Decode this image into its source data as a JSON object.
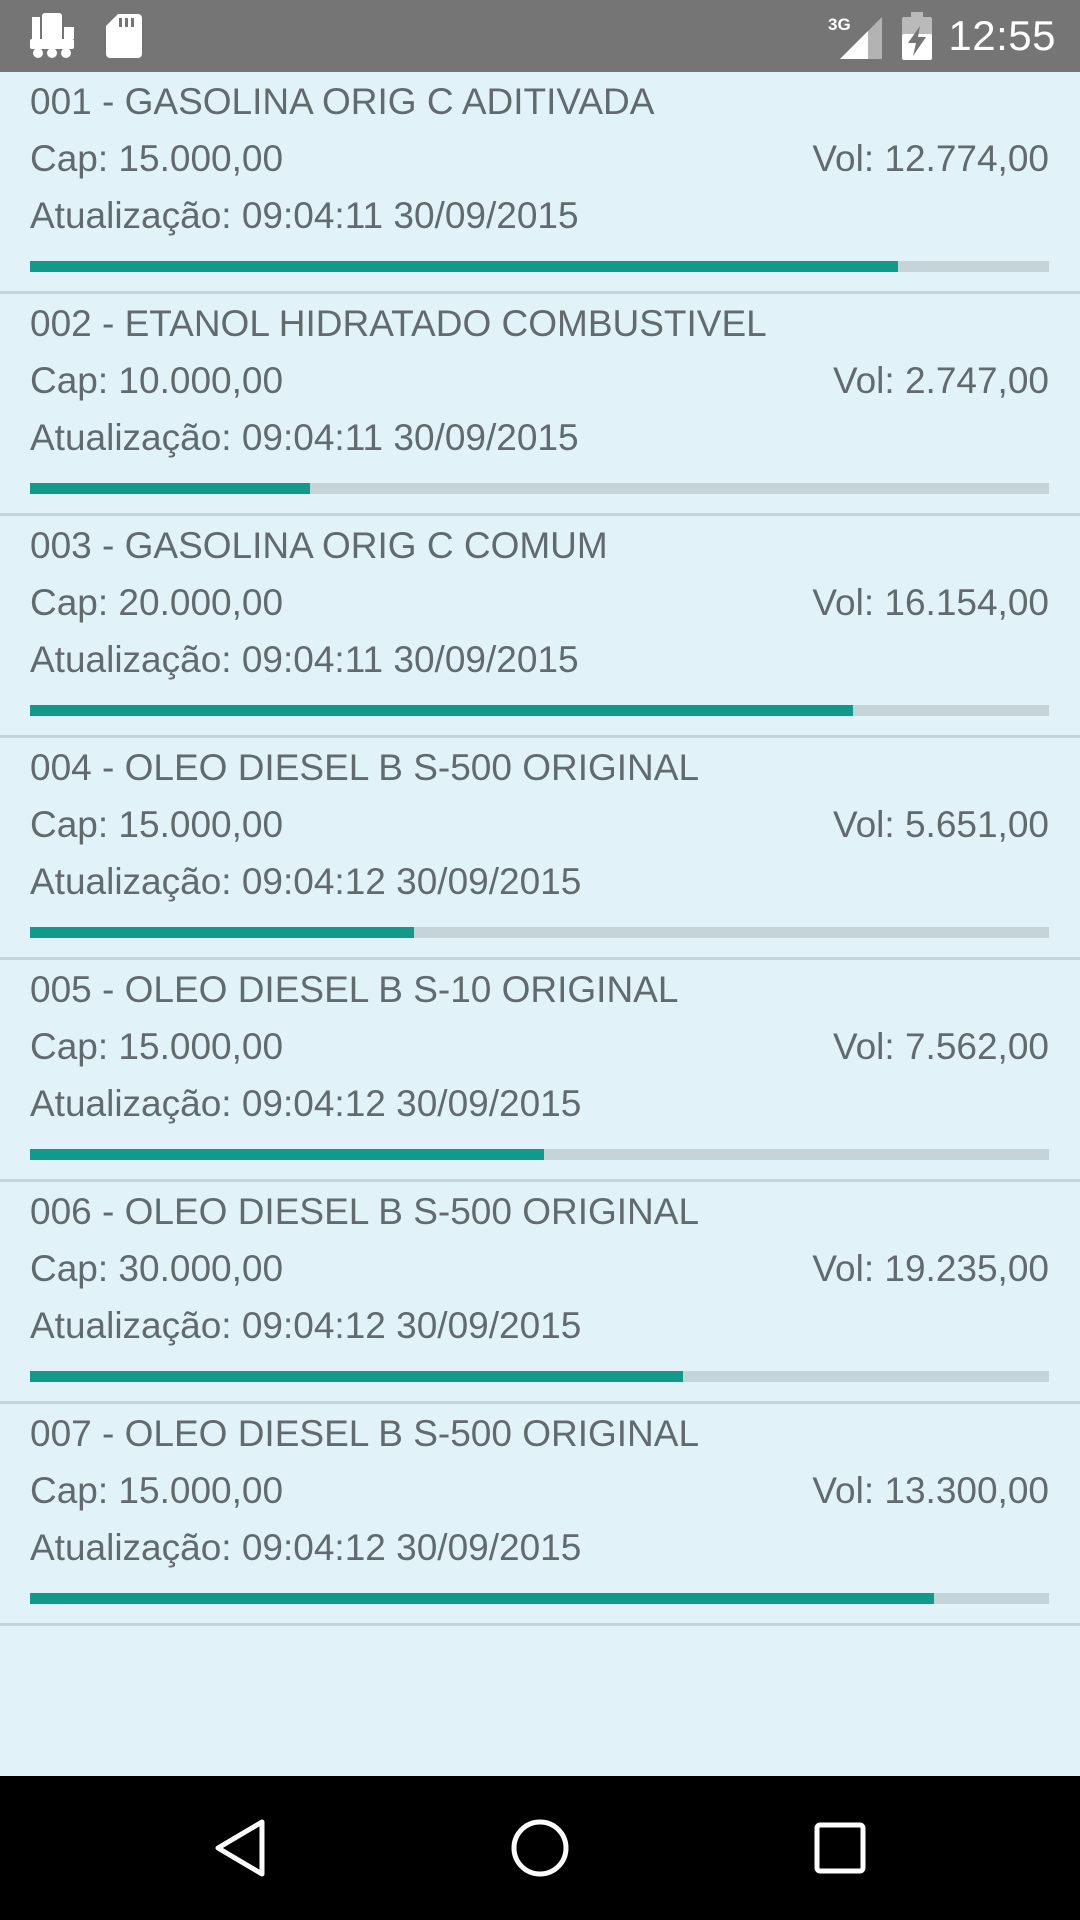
{
  "status_bar": {
    "time": "12:55",
    "network": "3G",
    "icons_left": [
      "tanker-truck-icon",
      "sd-card-icon"
    ],
    "icons_right": [
      "signal-3g-icon",
      "battery-charging-icon"
    ]
  },
  "tanks": [
    {
      "name": "001 - GASOLINA ORIG C ADITIVADA",
      "cap": "Cap: 15.000,00",
      "vol": "Vol: 12.774,00",
      "updated": "Atualização: 09:04:11 30/09/2015",
      "fill_fraction": 0.8516
    },
    {
      "name": "002 - ETANOL HIDRATADO COMBUSTIVEL",
      "cap": "Cap: 10.000,00",
      "vol": "Vol: 2.747,00",
      "updated": "Atualização: 09:04:11 30/09/2015",
      "fill_fraction": 0.2747
    },
    {
      "name": "003 - GASOLINA ORIG C COMUM",
      "cap": "Cap: 20.000,00",
      "vol": "Vol: 16.154,00",
      "updated": "Atualização: 09:04:11 30/09/2015",
      "fill_fraction": 0.8077
    },
    {
      "name": "004 - OLEO DIESEL B S-500 ORIGINAL",
      "cap": "Cap: 15.000,00",
      "vol": "Vol: 5.651,00",
      "updated": "Atualização: 09:04:12 30/09/2015",
      "fill_fraction": 0.3767
    },
    {
      "name": "005 - OLEO DIESEL B S-10 ORIGINAL",
      "cap": "Cap: 15.000,00",
      "vol": "Vol: 7.562,00",
      "updated": "Atualização: 09:04:12 30/09/2015",
      "fill_fraction": 0.5041
    },
    {
      "name": "006 - OLEO DIESEL B S-500 ORIGINAL",
      "cap": "Cap: 30.000,00",
      "vol": "Vol: 19.235,00",
      "updated": "Atualização: 09:04:12 30/09/2015",
      "fill_fraction": 0.6412
    },
    {
      "name": "007 - OLEO DIESEL B S-500 ORIGINAL",
      "cap": "Cap: 15.000,00",
      "vol": "Vol: 13.300,00",
      "updated": "Atualização: 09:04:12 30/09/2015",
      "fill_fraction": 0.8867
    }
  ],
  "colors": {
    "background": "#e1f3f8",
    "text": "#616a6e",
    "bar_fill": "#119a8a",
    "bar_track": "#c4d4d8",
    "status_bar": "#757575",
    "nav_bar": "#000000"
  },
  "nav_bar": {
    "buttons": [
      "back-icon",
      "home-icon",
      "recents-icon"
    ]
  }
}
